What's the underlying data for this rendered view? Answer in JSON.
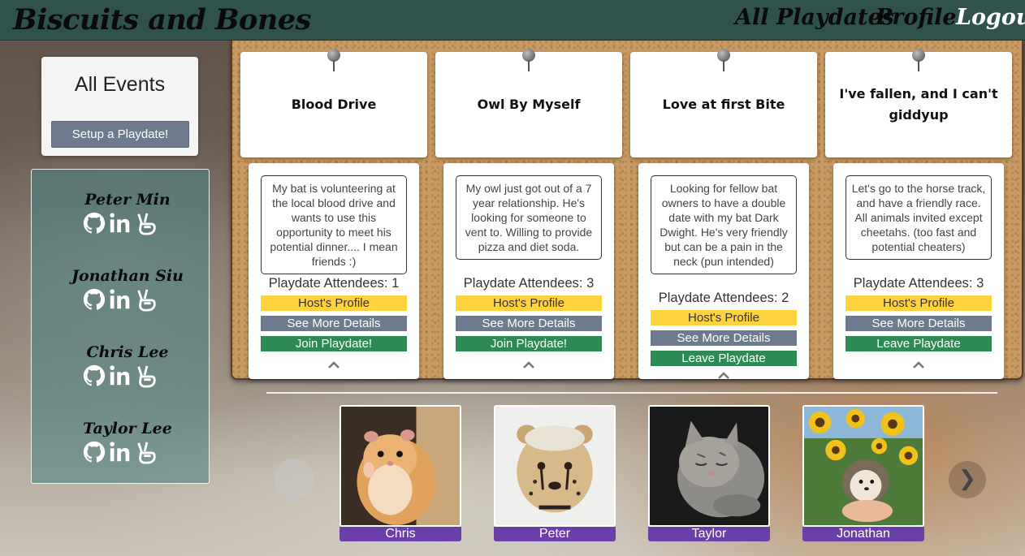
{
  "navbar": {
    "brand": "Biscuits and Bones",
    "links": [
      "All Playdates",
      "Profile",
      "Logout"
    ]
  },
  "sidebar": {
    "events_title": "All Events",
    "setup_button": "Setup a Playdate!",
    "developers": [
      {
        "name": "Peter Min"
      },
      {
        "name": "Jonathan Siu"
      },
      {
        "name": "Chris Lee"
      },
      {
        "name": "Taylor Lee"
      }
    ]
  },
  "playdates": [
    {
      "title": "Blood Drive",
      "description": "My bat is volunteering at the local blood drive and wants to use this opportunity to meet his potential dinner.... I mean friends :)",
      "attendees": "Playdate Attendees: 1",
      "host_button": "Host's Profile",
      "details_button": "See More Details",
      "action_button": "Join Playdate!"
    },
    {
      "title": "Owl By Myself",
      "description": "My owl just got out of a 7 year relationship. He's looking for someone to vent to. Willing to provide pizza and diet soda.",
      "attendees": "Playdate Attendees: 3",
      "host_button": "Host's Profile",
      "details_button": "See More Details",
      "action_button": "Join Playdate!"
    },
    {
      "title": "Love at first Bite",
      "description": "Looking for fellow bat owners to have a double date with my bat Dark Dwight. He's very friendly but can be a pain in the neck (pun intended)",
      "attendees": "Playdate Attendees: 2",
      "host_button": "Host's Profile",
      "details_button": "See More Details",
      "action_button": "Leave Playdate"
    },
    {
      "title": "I've fallen, and I can't giddyup",
      "description": "Let's go to the horse track, and have a friendly race. All animals invited except cheetahs. (too fast and potential cheaters)",
      "attendees": "Playdate Attendees: 3",
      "host_button": "Host's Profile",
      "details_button": "See More Details",
      "action_button": "Leave Playdate"
    }
  ],
  "pets": [
    {
      "name": "Chris",
      "photo": "hamster"
    },
    {
      "name": "Peter",
      "photo": "cheetah-cub"
    },
    {
      "name": "Taylor",
      "photo": "sleeping-cat"
    },
    {
      "name": "Jonathan",
      "photo": "hedgehog-sunflowers"
    }
  ],
  "carousel": {
    "next_icon": "❯"
  },
  "colors": {
    "navbar": "#2f524d",
    "host_button": "#ffd23f",
    "details_button": "#6e7a8e",
    "action_button": "#2e8a55",
    "pet_label": "#6a3fa8"
  }
}
